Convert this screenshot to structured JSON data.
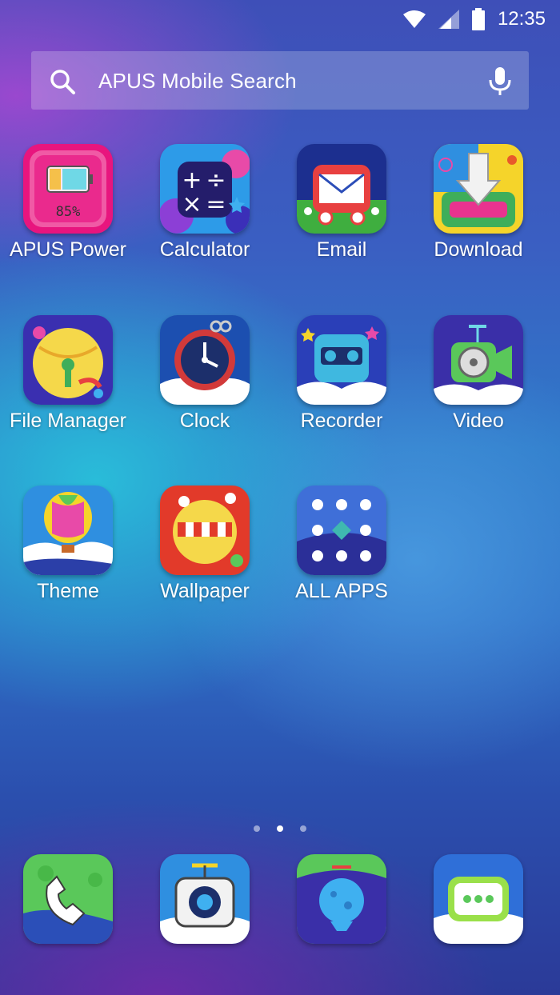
{
  "status_bar": {
    "time": "12:35"
  },
  "search": {
    "placeholder": "APUS Mobile Search"
  },
  "apps": [
    {
      "label": "APUS Power",
      "badge": "85%"
    },
    {
      "label": "Calculator"
    },
    {
      "label": "Email"
    },
    {
      "label": "Download"
    },
    {
      "label": "File Manager"
    },
    {
      "label": "Clock"
    },
    {
      "label": "Recorder"
    },
    {
      "label": "Video"
    },
    {
      "label": "Theme"
    },
    {
      "label": "Wallpaper"
    },
    {
      "label": "ALL APPS"
    }
  ],
  "pager": {
    "pages": 3,
    "current": 2
  },
  "dock": [
    {
      "icon": "phone-icon"
    },
    {
      "icon": "camera-icon"
    },
    {
      "icon": "browser-icon"
    },
    {
      "icon": "messages-icon"
    }
  ]
}
